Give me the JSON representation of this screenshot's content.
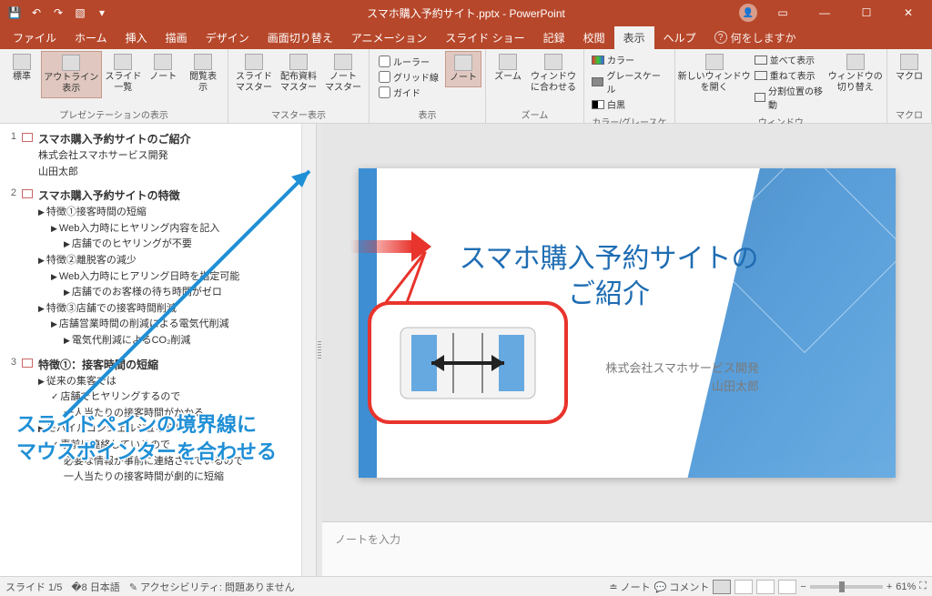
{
  "app": {
    "title": "スマホ購入予約サイト.pptx - PowerPoint"
  },
  "qat": [
    "save",
    "undo",
    "redo",
    "start"
  ],
  "menu": {
    "tabs": [
      "ファイル",
      "ホーム",
      "挿入",
      "描画",
      "デザイン",
      "画面切り替え",
      "アニメーション",
      "スライド ショー",
      "記録",
      "校閲",
      "表示",
      "ヘルプ"
    ],
    "active": 10,
    "tellme": "何をしますか"
  },
  "ribbon": {
    "presentation_views": {
      "label": "プレゼンテーションの表示",
      "buttons": [
        {
          "name": "normal-view",
          "label": "標準"
        },
        {
          "name": "outline-view",
          "label": "アウトライン\n表示",
          "active": true
        },
        {
          "name": "slide-sorter",
          "label": "スライド\n一覧"
        },
        {
          "name": "notes-page",
          "label": "ノート"
        },
        {
          "name": "reading-view",
          "label": "閲覧表示"
        }
      ]
    },
    "master_views": {
      "label": "マスター表示",
      "buttons": [
        {
          "name": "slide-master",
          "label": "スライド\nマスター"
        },
        {
          "name": "handout-master",
          "label": "配布資料\nマスター"
        },
        {
          "name": "notes-master",
          "label": "ノート\nマスター"
        }
      ]
    },
    "show": {
      "label": "表示",
      "checks": [
        "ルーラー",
        "グリッド線",
        "ガイド"
      ],
      "notes_btn": "ノート"
    },
    "zoom": {
      "label": "ズーム",
      "buttons": [
        {
          "name": "zoom",
          "label": "ズーム"
        },
        {
          "name": "fit-window",
          "label": "ウィンドウ\nに合わせる"
        }
      ]
    },
    "color": {
      "label": "カラー/グレースケール",
      "rows": [
        {
          "swatch": "linear-gradient(90deg,#e33,#3c3,#36e)",
          "label": "カラー"
        },
        {
          "swatch": "#888",
          "label": "グレースケール"
        },
        {
          "swatch": "linear-gradient(90deg,#000 50%,#fff 50%)",
          "label": "白黒"
        }
      ]
    },
    "window": {
      "label": "ウィンドウ",
      "big": "新しいウィンドウ\nを開く",
      "items": [
        "並べて表示",
        "重ねて表示",
        "分割位置の移動"
      ]
    },
    "switch": {
      "label": "",
      "btn": "ウィンドウの\n切り替え"
    },
    "macro": {
      "label": "マクロ",
      "btn": "マクロ"
    }
  },
  "outline": [
    {
      "n": "1",
      "title": "スマホ購入予約サイトのご紹介",
      "lines": [
        {
          "cls": "",
          "t": "株式会社スマホサービス開発"
        },
        {
          "cls": "",
          "t": "山田太郎"
        }
      ]
    },
    {
      "n": "2",
      "title": "スマホ購入予約サイトの特徴",
      "lines": [
        {
          "cls": "lv1",
          "t": "特徴①接客時間の短縮"
        },
        {
          "cls": "lv2",
          "t": "Web入力時にヒヤリング内容を記入"
        },
        {
          "cls": "lv3",
          "t": "店舗でのヒヤリングが不要"
        },
        {
          "cls": "lv1",
          "t": "特徴②離脱客の減少"
        },
        {
          "cls": "lv2",
          "t": "Web入力時にヒアリング日時を指定可能"
        },
        {
          "cls": "lv3",
          "t": "店舗でのお客様の待ち時間がゼロ"
        },
        {
          "cls": "lv1",
          "t": "特徴③店舗での接客時間削減"
        },
        {
          "cls": "lv2",
          "t": "店舗営業時間の削減による電気代削減"
        },
        {
          "cls": "lv3",
          "t": "電気代削減によるCO₂削減"
        }
      ]
    },
    {
      "n": "3",
      "title": "特徴①：接客時間の短縮",
      "lines": [
        {
          "cls": "lv1",
          "t": "従来の集客では"
        },
        {
          "cls": "lvc",
          "t": "店舗でヒヤリングするので"
        },
        {
          "cls": "plain",
          "t": "一人当たりの接客時間がかかる"
        },
        {
          "cls": "lv1",
          "t": "モバイルコンシェルジュならば"
        },
        {
          "cls": "lvc",
          "t": "事前に連絡しているので"
        },
        {
          "cls": "plain",
          "t": "必要な情報が事前に連絡されているので"
        },
        {
          "cls": "plain",
          "t": "一人当たりの接客時間が劇的に短縮"
        }
      ]
    }
  ],
  "slide": {
    "title": "スマホ購入予約サイトの\nご紹介",
    "sub1": "株式会社スマホサービス開発",
    "sub2": "山田太郎"
  },
  "notes": {
    "placeholder": "ノートを入力"
  },
  "status": {
    "slide": "スライド 1/5",
    "lang": "日本語",
    "a11y": "アクセシビリティ: 問題ありません",
    "notes_btn": "ノート",
    "comments_btn": "コメント",
    "zoom": "61%"
  },
  "annotation": {
    "text": "スライドペインの境界線に\nマウスポインターを合わせる"
  }
}
